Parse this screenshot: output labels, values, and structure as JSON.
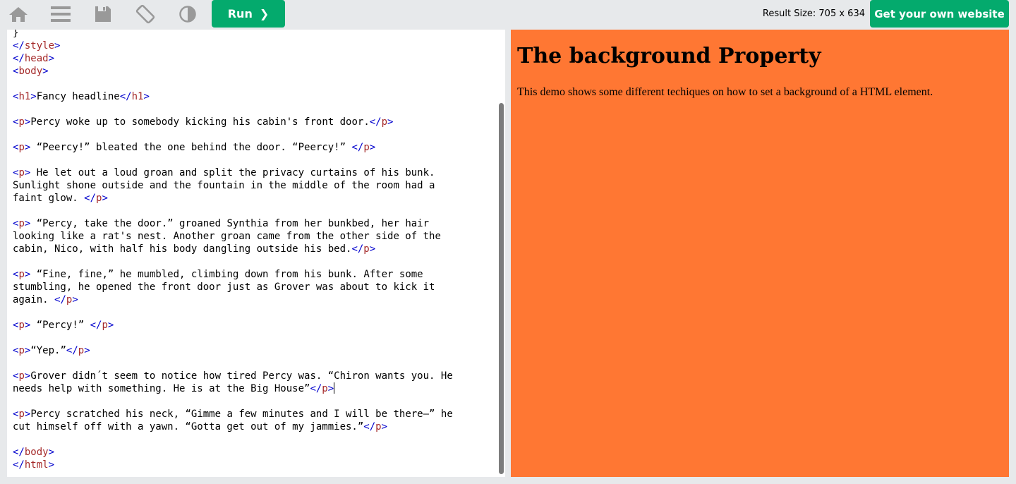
{
  "toolbar": {
    "icons": [
      "home-icon",
      "menu-icon",
      "save-icon",
      "rotate-icon",
      "theme-icon"
    ],
    "run_label": "Run",
    "run_chevron": "❯",
    "result_size": "Result Size: 705 x 634",
    "get_website_label": "Get your own website"
  },
  "colors": {
    "accent": "#04aa6d",
    "result_bg": "#ff7733",
    "tag": "#a52a2a",
    "bracket": "#0000cd"
  },
  "code_lines": [
    "}",
    "</style>",
    "</head>",
    "<body>",
    "",
    "<h1>Fancy headline</h1>",
    "",
    "<p>Percy woke up to somebody kicking his cabin's front door.</p>",
    "",
    "<p> “Peercy!” bleated the one behind the door. “Peercy!” </p>",
    "",
    "<p> He let out a loud groan and split the privacy curtains of his bunk.",
    "Sunlight shone outside and the fountain in the middle of the room had a",
    "faint glow. </p>",
    "",
    "<p> “Percy, take the door.” groaned Synthia from her bunkbed, her hair",
    "looking like a rat's nest. Another groan came from the other side of the",
    "cabin, Nico, with half his body dangling outside his bed.</p>",
    "",
    "<p> “Fine, fine,” he mumbled, climbing down from his bunk. After some",
    "stumbling, he opened the front door just as Grover was about to kick it",
    "again. </p>",
    "",
    "<p> “Percy!” </p>",
    "",
    "<p>“Yep.”</p>",
    "",
    "<p>Grover didn´t seem to notice how tired Percy was. “Chiron wants you. He",
    "needs help with something. He is at the Big House”</p>",
    "",
    "<p>Percy scratched his neck, “Gimme a few minutes and I will be there—” he",
    "cut himself off with a yawn. “Gotta get out of my jammies.”</p>",
    "",
    "</body>",
    "</html>"
  ],
  "cursor_line": 28,
  "result": {
    "heading": "The background Property",
    "paragraph": "This demo shows some different techiques on how to set a background of a HTML element."
  }
}
